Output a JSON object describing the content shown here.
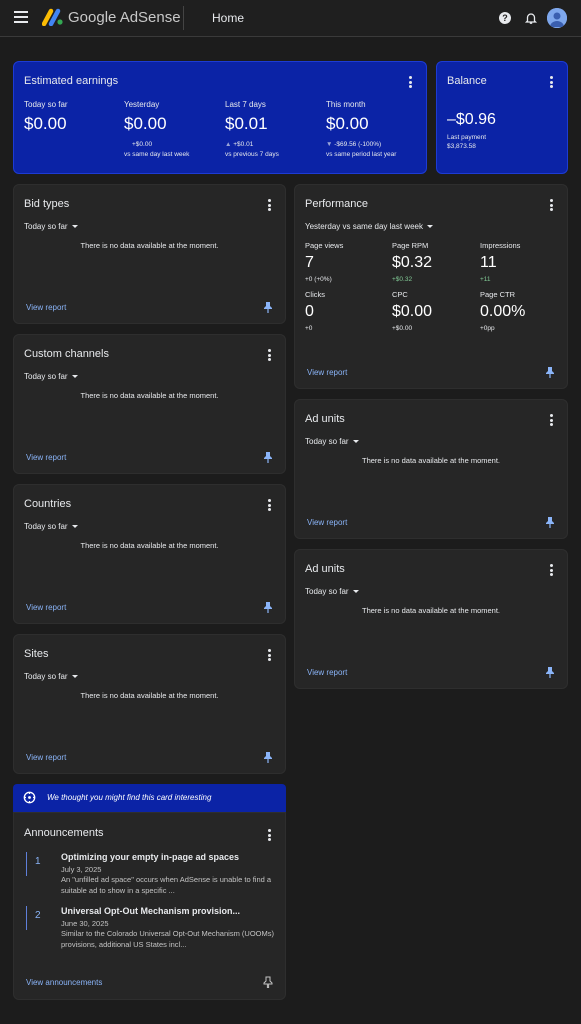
{
  "header": {
    "brand": "Google AdSense",
    "page": "Home"
  },
  "estimated_earnings": {
    "title": "Estimated earnings",
    "metrics": [
      {
        "label": "Today so far",
        "value": "$0.00",
        "delta": "",
        "compare": ""
      },
      {
        "label": "Yesterday",
        "value": "$0.00",
        "delta": "+$0.00",
        "compare": "vs same day last week"
      },
      {
        "label": "Last 7 days",
        "value": "$0.01",
        "delta": "+$0.01",
        "compare": "vs previous 7 days"
      },
      {
        "label": "This month",
        "value": "$0.00",
        "delta": "-$69.56 (-100%)",
        "compare": "vs same period last year"
      }
    ]
  },
  "balance": {
    "title": "Balance",
    "value": "–$0.96",
    "last_payment_label": "Last payment",
    "last_payment_value": "$3,873.58"
  },
  "bid_types": {
    "title": "Bid types",
    "range": "Today so far",
    "empty": "There is no data available at the moment.",
    "link": "View report"
  },
  "custom_channels": {
    "title": "Custom channels",
    "range": "Today so far",
    "empty": "There is no data available at the moment.",
    "link": "View report"
  },
  "countries": {
    "title": "Countries",
    "range": "Today so far",
    "empty": "There is no data available at the moment.",
    "link": "View report"
  },
  "sites": {
    "title": "Sites",
    "range": "Today so far",
    "empty": "There is no data available at the moment.",
    "link": "View report"
  },
  "performance": {
    "title": "Performance",
    "range": "Yesterday vs same day last week",
    "metrics": [
      {
        "label": "Page views",
        "value": "7",
        "delta": "+0 (+0%)",
        "positive": false
      },
      {
        "label": "Page RPM",
        "value": "$0.32",
        "delta": "+$0.32",
        "positive": true
      },
      {
        "label": "Impressions",
        "value": "11",
        "delta": "+11",
        "positive": true
      },
      {
        "label": "Clicks",
        "value": "0",
        "delta": "+0",
        "positive": false
      },
      {
        "label": "CPC",
        "value": "$0.00",
        "delta": "+$0.00",
        "positive": false
      },
      {
        "label": "Page CTR",
        "value": "0.00%",
        "delta": "+0pp",
        "positive": false
      }
    ],
    "link": "View report"
  },
  "ad_units_1": {
    "title": "Ad units",
    "range": "Today so far",
    "empty": "There is no data available at the moment.",
    "link": "View report"
  },
  "ad_units_2": {
    "title": "Ad units",
    "range": "Today so far",
    "empty": "There is no data available at the moment.",
    "link": "View report"
  },
  "banner": {
    "text": "We thought you might find this card interesting"
  },
  "announcements": {
    "title": "Announcements",
    "items": [
      {
        "num": "1",
        "title": "Optimizing your empty in-page ad spaces",
        "date": "July 3, 2025",
        "desc": "An \"unfilled ad space\" occurs when AdSense is unable to find a suitable ad to show in a specific ..."
      },
      {
        "num": "2",
        "title": "Universal Opt-Out Mechanism provision...",
        "date": "June 30, 2025",
        "desc": "Similar to the Colorado Universal Opt-Out Mechanism (UOOMs) provisions, additional US States incl..."
      }
    ],
    "link": "View announcements"
  },
  "colors": {
    "accent_blue": "#0b23a6",
    "link": "#8ab4f8",
    "positive": "#81c995",
    "background": "#1c1c1c",
    "card": "#262626"
  }
}
